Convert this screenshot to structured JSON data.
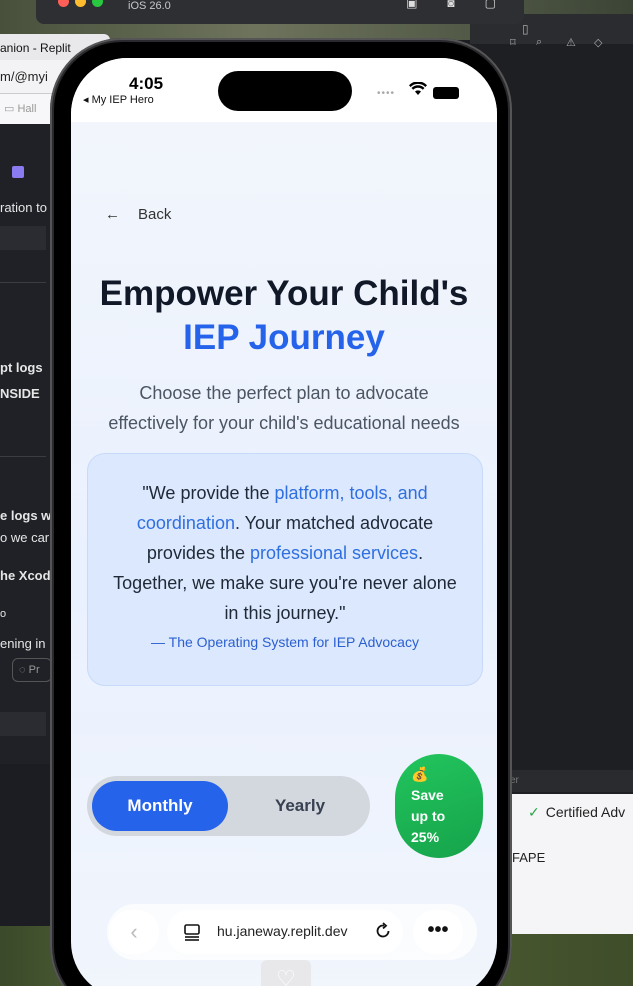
{
  "desktop": {
    "simulator_title": "iOS 26.0",
    "left_window": {
      "tab_title": "anion - Replit",
      "url": "m/@myi",
      "folder": "Hall",
      "lines": [
        "ration to",
        "pt logs",
        "NSIDE",
        "e logs w",
        "o we car",
        "he Xcod",
        "o",
        "ening in",
        "Pr"
      ]
    },
    "right_window": {
      "panel_label": "er",
      "certified_label": "Certified Adv",
      "fape": "FAPE"
    }
  },
  "phone": {
    "status": {
      "time": "4:05",
      "back_app": "◂ My IEP Hero"
    },
    "back_label": "Back",
    "headline_1": "Empower Your Child's",
    "headline_2": "IEP Journey",
    "subtitle_1": "Choose the perfect plan to advocate",
    "subtitle_2": "effectively for your child's educational needs",
    "quote": {
      "p1": "\"We provide the ",
      "h1": "platform, tools, and coordination",
      "p2": ". Your matched advocate provides the ",
      "h2": "professional services",
      "p3": ". Together, we make sure you're never alone in this journey.\"",
      "attribution": "— The Operating System for IEP Advocacy"
    },
    "billing": {
      "monthly": "Monthly",
      "yearly": "Yearly",
      "selected": "Monthly"
    },
    "save_badge": {
      "emoji": "💰",
      "line1": "Save",
      "line2": "up to",
      "line3": "25%"
    },
    "browser": {
      "url": "hu.janeway.replit.dev"
    }
  }
}
